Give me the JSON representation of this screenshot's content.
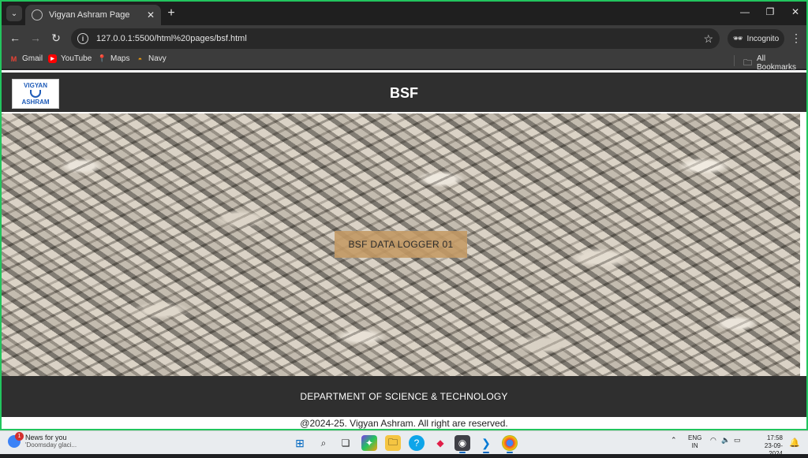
{
  "browser": {
    "tab_title": "Vigyan Ashram Page",
    "url": "127.0.0.1:5500/html%20pages/bsf.html",
    "incognito_label": "Incognito",
    "bookmarks": [
      {
        "label": "Gmail",
        "icon": "gmail-icon"
      },
      {
        "label": "YouTube",
        "icon": "youtube-icon"
      },
      {
        "label": "Maps",
        "icon": "maps-icon"
      },
      {
        "label": "Navy",
        "icon": "navy-icon"
      }
    ],
    "all_bookmarks_label": "All Bookmarks"
  },
  "page": {
    "logo_line1": "VIGYAN",
    "logo_line2": "ASHRAM",
    "title": "BSF",
    "hero_button": "BSF DATA LOGGER 01",
    "footer_text": "DEPARTMENT OF SCIENCE & TECHNOLOGY",
    "copyright": "@2024-25. Vigyan Ashram. All right are reserved."
  },
  "taskbar": {
    "news_title": "News for you",
    "news_sub": "'Doomsday glaci...",
    "news_badge": "1",
    "lang_line1": "ENG",
    "lang_line2": "IN",
    "time": "17:58",
    "date": "23-09-2024"
  },
  "colors": {
    "header_bg": "#2f2f2f",
    "hero_button_bg": "#c49a64",
    "window_border": "#22c55e"
  }
}
